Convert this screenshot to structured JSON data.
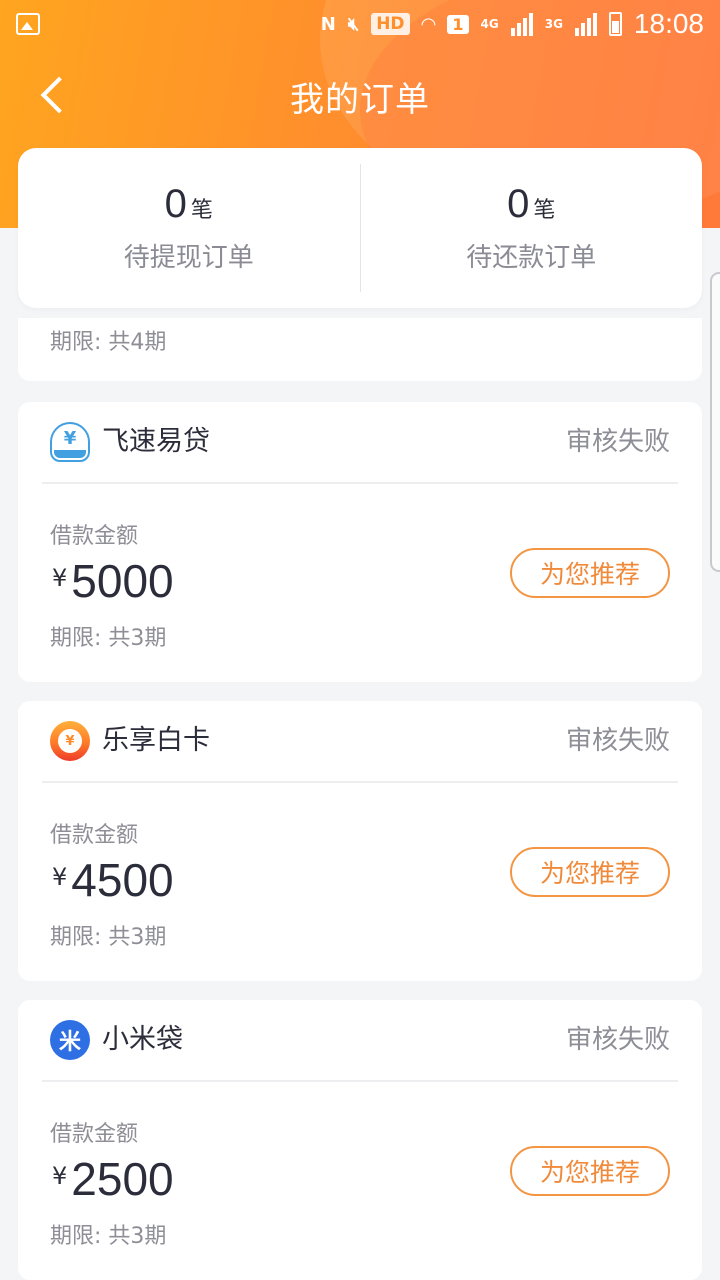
{
  "status_bar": {
    "hd": "HD",
    "sim": "1",
    "net1": "4G",
    "net2": "3G",
    "time": "18:08"
  },
  "nav": {
    "title": "我的订单",
    "back_icon": "chevron-left-icon"
  },
  "summary": {
    "pending_withdraw": {
      "count": "0",
      "unit": "笔",
      "label": "待提现订单"
    },
    "pending_repay": {
      "count": "0",
      "unit": "笔",
      "label": "待还款订单"
    }
  },
  "partial_card": {
    "term": "期限: 共4期"
  },
  "orders": [
    {
      "logo_text": "¥",
      "name": "飞速易贷",
      "status": "审核失败",
      "amount_label": "借款金额",
      "currency": "¥",
      "amount": "5000",
      "term": "期限: 共3期",
      "button": "为您推荐"
    },
    {
      "logo_text": "¥",
      "name": "乐享白卡",
      "status": "审核失败",
      "amount_label": "借款金额",
      "currency": "¥",
      "amount": "4500",
      "term": "期限: 共3期",
      "button": "为您推荐"
    },
    {
      "logo_text": "米",
      "name": "小米袋",
      "status": "审核失败",
      "amount_label": "借款金额",
      "currency": "¥",
      "amount": "2500",
      "term": "期限: 共3期",
      "button": "为您推荐"
    }
  ],
  "colors": {
    "header_start": "#ffa51f",
    "header_end": "#ff7a38",
    "accent": "#f08a3a",
    "text_primary": "#2c2d3a",
    "text_secondary": "#8e8e97"
  }
}
